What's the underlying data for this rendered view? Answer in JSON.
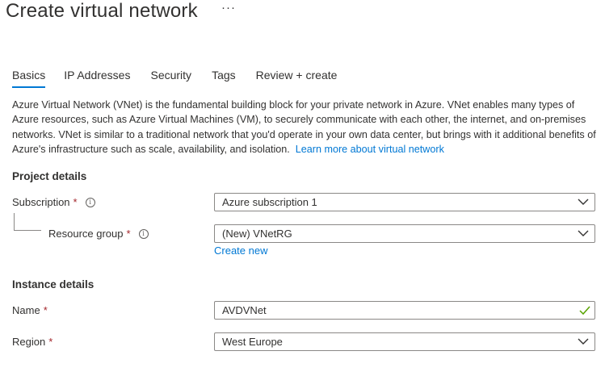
{
  "page": {
    "title": "Create virtual network",
    "more_label": "···"
  },
  "tabs": [
    {
      "label": "Basics",
      "active": true
    },
    {
      "label": "IP Addresses",
      "active": false
    },
    {
      "label": "Security",
      "active": false
    },
    {
      "label": "Tags",
      "active": false
    },
    {
      "label": "Review + create",
      "active": false
    }
  ],
  "description": {
    "text": "Azure Virtual Network (VNet) is the fundamental building block for your private network in Azure. VNet enables many types of Azure resources, such as Azure Virtual Machines (VM), to securely communicate with each other, the internet, and on-premises networks. VNet is similar to a traditional network that you'd operate in your own data center, but brings with it additional benefits of Azure's infrastructure such as scale, availability, and isolation.",
    "link": "Learn more about virtual network"
  },
  "project_details": {
    "heading": "Project details",
    "subscription": {
      "label": "Subscription",
      "required": "*",
      "info_icon": "i",
      "value": "Azure subscription 1"
    },
    "resource_group": {
      "label": "Resource group",
      "required": "*",
      "info_icon": "i",
      "value": "(New) VNetRG",
      "create_new": "Create new"
    }
  },
  "instance_details": {
    "heading": "Instance details",
    "name": {
      "label": "Name",
      "required": "*",
      "value": "AVDVNet"
    },
    "region": {
      "label": "Region",
      "required": "*",
      "value": "West Europe"
    }
  },
  "colors": {
    "accent": "#0078d4",
    "required": "#a4262c",
    "valid": "#57a300",
    "border": "#8a8886"
  }
}
